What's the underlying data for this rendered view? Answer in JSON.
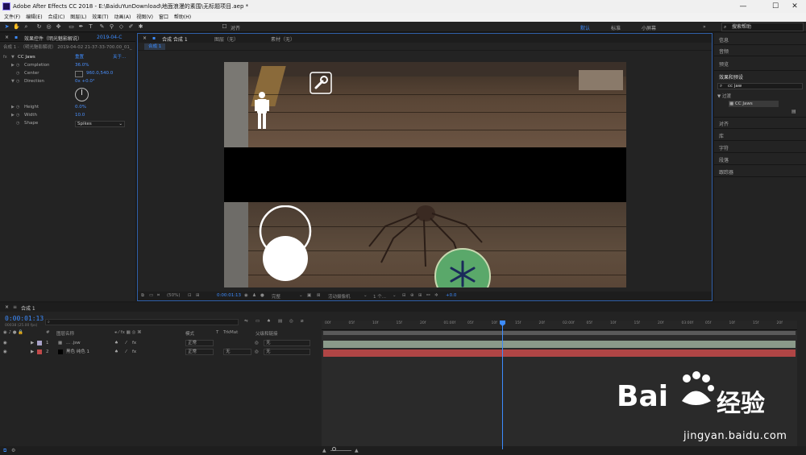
{
  "window": {
    "title": "Adobe After Effects CC 2018 - E:\\BaiduYunDownload\\地面浪漫的素围\\无标题项目.aep *",
    "minimize": "—",
    "maximize": "☐",
    "close": "✕"
  },
  "menu": [
    "文件(F)",
    "编辑(E)",
    "合成(C)",
    "图层(L)",
    "效果(T)",
    "动画(A)",
    "视图(V)",
    "窗口",
    "帮助(H)"
  ],
  "toolbar": {
    "snap_label": "对齐",
    "workspaces": [
      "默认",
      "标准",
      "小屏幕"
    ],
    "active_workspace": "默认",
    "search_placeholder": "搜索帮助"
  },
  "effect_controls": {
    "tab_label": "效果控件（明光魅影解说）",
    "tab_date": "2019-04-C",
    "breadcrumb": "合成 1 · （明光魅影解说） 2019-04-02 21-37-33-700.00_01_",
    "effect_name": "CC Jaws",
    "reset": "重置",
    "about": "关于...",
    "properties": [
      {
        "label": "Completion",
        "value": "36.0%"
      },
      {
        "label": "Center",
        "value": "960.0,540.0"
      },
      {
        "label": "Direction",
        "value": "0x +0.0°"
      },
      {
        "label": "Height",
        "value": "0.0%"
      },
      {
        "label": "Width",
        "value": "10.0"
      },
      {
        "label": "Shape",
        "value": "Spikes"
      }
    ]
  },
  "composition": {
    "tab_label": "合成 合成 1",
    "layer_tab": "图层（无）",
    "footage_tab": "素材（无）",
    "sub_tab": "合成 1",
    "footer": {
      "zoom": "(50%)",
      "time": "0:00:01:13",
      "resolution": "完整",
      "camera": "活动摄像机",
      "views": "1 个...",
      "exposure": "+0.0"
    }
  },
  "right_panel": {
    "items_top": [
      "信息",
      "音频",
      "预览"
    ],
    "effects_title": "效果和预设",
    "effects_search": "cc jaw",
    "category": "过渡",
    "result": "CC Jaws",
    "items_bottom": [
      "对齐",
      "库",
      "字符",
      "段落",
      "跟踪器"
    ]
  },
  "timeline": {
    "tab_label": "合成 1",
    "timecode": "0:00:01:13",
    "fps": "00038 (25.00 fps)",
    "columns": {
      "name": "图层名称",
      "mode": "模式",
      "t": "T",
      "trkmat": "TrkMat",
      "parent": "父级和链接"
    },
    "layers": [
      {
        "num": "1",
        "name": "... .jsw",
        "mode": "正常",
        "trkmat": "",
        "parent": "无",
        "color": "#a9a3c9"
      },
      {
        "num": "2",
        "name": "黑色 纯色 1",
        "mode": "正常",
        "trkmat": "无",
        "parent": "无",
        "color": "#c24a4a"
      }
    ],
    "ruler": [
      "00f",
      "05f",
      "10f",
      "15f",
      "20f",
      "01:00f",
      "05f",
      "10f",
      "15f",
      "20f",
      "02:00f",
      "05f",
      "10f",
      "15f",
      "20f",
      "03:00f",
      "05f",
      "10f",
      "15f",
      "20f"
    ]
  },
  "watermark": {
    "brand": "Bai",
    "brand2": "经验",
    "url": "jingyan.baidu.com"
  },
  "colors": {
    "accent": "#3d8cff",
    "layer1_bar": "#8a9a8a",
    "layer2_bar": "#b04545"
  }
}
